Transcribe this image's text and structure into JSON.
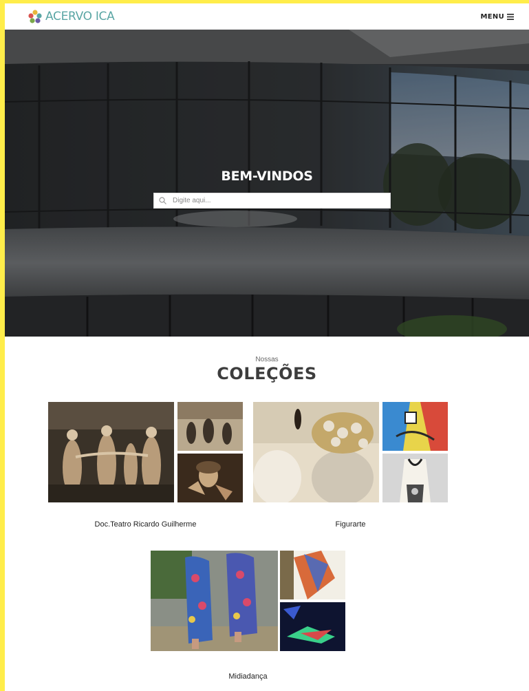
{
  "header": {
    "brand": "ACERVO ICA",
    "menu_label": "MENU"
  },
  "hero": {
    "title": "BEM-VINDOS",
    "search_placeholder": "Digite aqui..."
  },
  "collections": {
    "pretitle": "Nossas",
    "title": "COLEÇÕES",
    "items": [
      {
        "label": "Doc.Teatro Ricardo Guilherme"
      },
      {
        "label": "Figurarte"
      },
      {
        "label": "Midiadança"
      }
    ]
  },
  "colors": {
    "frame": "#ffed4a",
    "brand": "#5aa6a4",
    "text_dark": "#3d3d3d"
  },
  "icons": [
    "logo-icon",
    "menu-icon",
    "search-icon"
  ]
}
